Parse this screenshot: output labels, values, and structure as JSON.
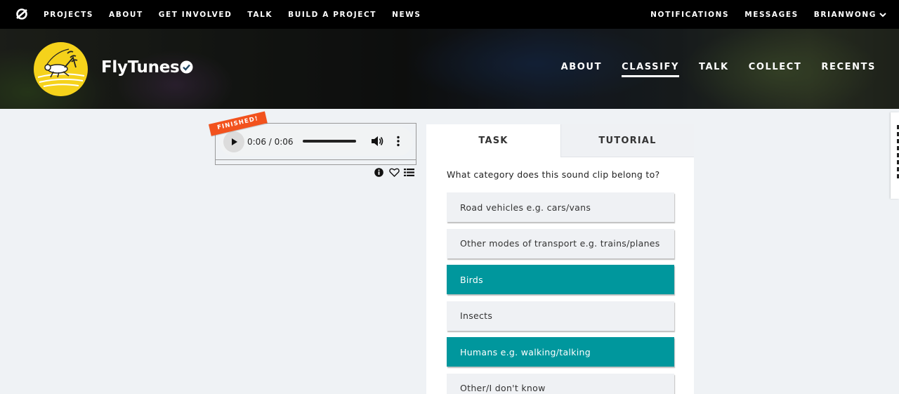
{
  "topbar": {
    "logo_icon": "zooniverse-logo-icon",
    "links": [
      "PROJECTS",
      "ABOUT",
      "GET INVOLVED",
      "TALK",
      "BUILD A PROJECT",
      "NEWS"
    ],
    "right": {
      "notifications": "NOTIFICATIONS",
      "messages": "MESSAGES",
      "user": "BRIANWONG"
    }
  },
  "project": {
    "title": "FlyTunes",
    "verified_icon": "verified-check-icon",
    "nav": [
      "ABOUT",
      "CLASSIFY",
      "TALK",
      "COLLECT",
      "RECENTS"
    ],
    "active_nav": "CLASSIFY"
  },
  "player": {
    "ribbon": "FINISHED!",
    "time": "0:06 / 0:06",
    "progress": 1.0
  },
  "task": {
    "tabs": {
      "task": "TASK",
      "tutorial": "TUTORIAL"
    },
    "question": "What category does this sound clip belong to?",
    "answers": [
      {
        "label": "Road vehicles e.g. cars/vans",
        "selected": false
      },
      {
        "label": "Other modes of transport e.g. trains/planes",
        "selected": false
      },
      {
        "label": "Birds",
        "selected": true
      },
      {
        "label": "Insects",
        "selected": false
      },
      {
        "label": "Humans e.g. walking/talking",
        "selected": true
      },
      {
        "label": "Other/I don't know",
        "selected": false
      }
    ]
  },
  "colors": {
    "accent": "#00979d",
    "ribbon": "#f2521d",
    "avatar_bg": "#f5d21b"
  }
}
